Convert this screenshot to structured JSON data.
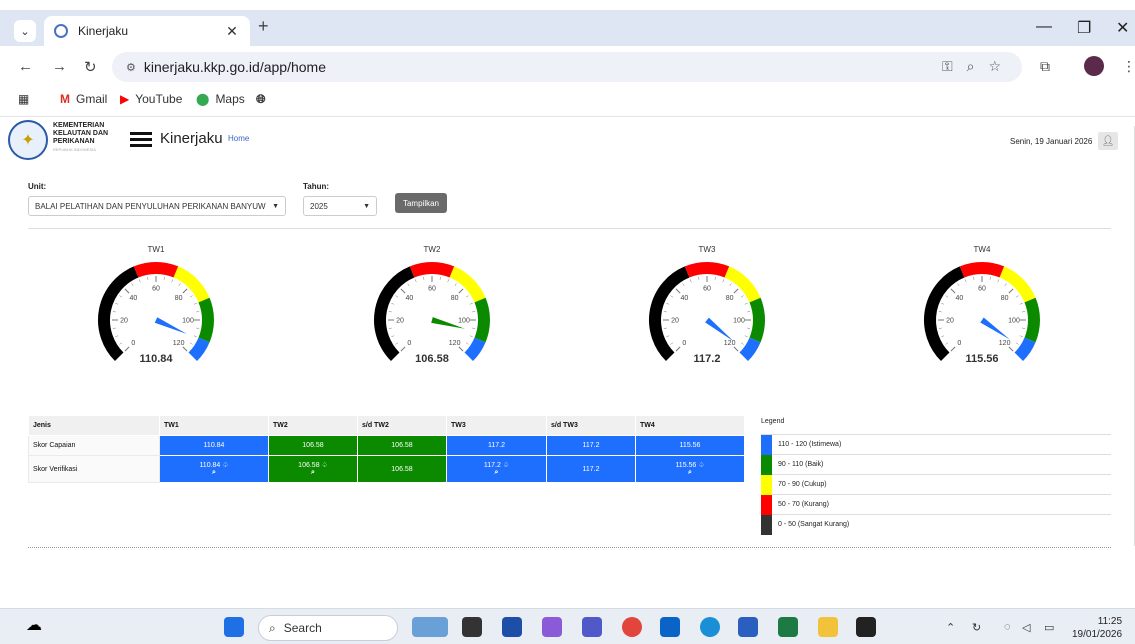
{
  "browser": {
    "tab_title": "Kinerjaku",
    "url": "kinerjaku.kkp.go.id/app/home",
    "bookmarks": [
      "Gmail",
      "YouTube",
      "Maps"
    ]
  },
  "header": {
    "org_line1": "KEMENTERIAN",
    "org_line2": "KELAUTAN DAN",
    "org_line3": "PERIKANAN",
    "org_sub": "REPUBLIK INDONESIA",
    "app_title": "Kinerjaku",
    "breadcrumb": "Home",
    "date": "Senin, 19 Januari 2026"
  },
  "filters": {
    "unit_label": "Unit:",
    "unit_value": "BALAI PELATIHAN DAN PENYULUHAN PERIKANAN BANYUW",
    "year_label": "Tahun:",
    "year_value": "2025",
    "submit_label": "Tampilkan"
  },
  "gauges": [
    {
      "title": "TW1",
      "value": 110.84,
      "display": "110.84"
    },
    {
      "title": "TW2",
      "value": 106.58,
      "display": "106.58"
    },
    {
      "title": "TW3",
      "value": 117.2,
      "display": "117.2"
    },
    {
      "title": "TW4",
      "value": 115.56,
      "display": "115.56"
    }
  ],
  "gauge_scale": {
    "min": 0,
    "max": 120,
    "tick_labels": [
      "0",
      "20",
      "40",
      "60",
      "80",
      "100",
      "120"
    ],
    "bands": [
      {
        "from": 0,
        "to": 50,
        "color": "#000000"
      },
      {
        "from": 50,
        "to": 70,
        "color": "#ff0000"
      },
      {
        "from": 70,
        "to": 90,
        "color": "#ffff00"
      },
      {
        "from": 90,
        "to": 110,
        "color": "#0b8a00"
      },
      {
        "from": 110,
        "to": 120,
        "color": "#1f6fff"
      }
    ]
  },
  "table": {
    "headers": [
      "Jenis",
      "TW1",
      "TW2",
      "s/d TW2",
      "TW3",
      "s/d TW3",
      "TW4"
    ],
    "rows": [
      {
        "label": "Skor Capaian",
        "cells": [
          {
            "value": "110.84",
            "color": "blue"
          },
          {
            "value": "106.58",
            "color": "green"
          },
          {
            "value": "106.58",
            "color": "green"
          },
          {
            "value": "117.2",
            "color": "blue"
          },
          {
            "value": "117.2",
            "color": "blue"
          },
          {
            "value": "115.56",
            "color": "blue"
          }
        ]
      },
      {
        "label": "Skor Verifikasi",
        "cells": [
          {
            "value": "110.84",
            "color": "blue",
            "icons": true
          },
          {
            "value": "106.58",
            "color": "green",
            "icons": true
          },
          {
            "value": "106.58",
            "color": "green",
            "icons": false
          },
          {
            "value": "117.2",
            "color": "blue",
            "icons": true
          },
          {
            "value": "117.2",
            "color": "blue",
            "icons": false
          },
          {
            "value": "115.56",
            "color": "blue",
            "icons": true
          }
        ]
      }
    ]
  },
  "legend": {
    "title": "Legend",
    "items": [
      {
        "label": "110 - 120 (Istimewa)",
        "color": "#1f6fff"
      },
      {
        "label": "90 - 110 (Baik)",
        "color": "#0b8a00"
      },
      {
        "label": "70 - 90 (Cukup)",
        "color": "#ffff00"
      },
      {
        "label": "50 - 70 (Kurang)",
        "color": "#ff0000"
      },
      {
        "label": "0 - 50 (Sangat Kurang)",
        "color": "#333333"
      }
    ]
  },
  "taskbar": {
    "search_label": "Search",
    "time": "11:25",
    "date": "19/01/2026"
  }
}
